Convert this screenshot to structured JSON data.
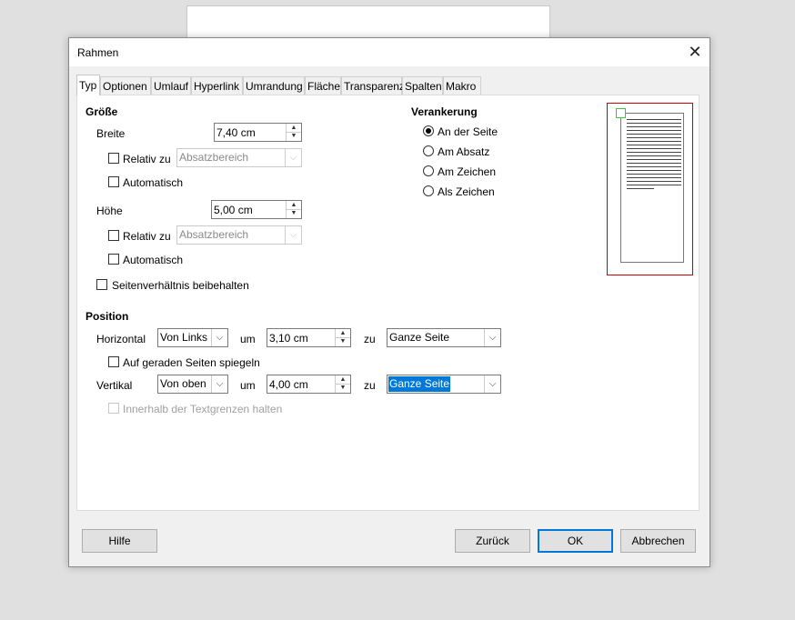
{
  "dialog": {
    "title": "Rahmen"
  },
  "tabs": [
    "Typ",
    "Optionen",
    "Umlauf",
    "Hyperlink",
    "Umrandung",
    "Fläche",
    "Transparenz",
    "Spalten",
    "Makro"
  ],
  "size": {
    "title": "Größe",
    "width_label": "Breite",
    "width_value": "7,40 cm",
    "width_relative_label": "Relativ zu",
    "width_relative_option": "Absatzbereich",
    "width_auto_label": "Automatisch",
    "height_label": "Höhe",
    "height_value": "5,00 cm",
    "height_relative_label": "Relativ zu",
    "height_relative_option": "Absatzbereich",
    "height_auto_label": "Automatisch",
    "keep_ratio_label": "Seitenverhältnis beibehalten"
  },
  "anchor": {
    "title": "Verankerung",
    "options": [
      "An der Seite",
      "Am Absatz",
      "Am Zeichen",
      "Als Zeichen"
    ],
    "selected": "An der Seite"
  },
  "position": {
    "title": "Position",
    "horizontal_label": "Horizontal",
    "horizontal_value": "Von Links",
    "by_label": "um",
    "horizontal_by": "3,10 cm",
    "to_label": "zu",
    "horizontal_to": "Ganze Seite",
    "mirror_label": "Auf geraden Seiten spiegeln",
    "vertical_label": "Vertikal",
    "vertical_value": "Von oben",
    "vertical_by": "4,00 cm",
    "vertical_to": "Ganze Seite",
    "follow_label": "Innerhalb der Textgrenzen halten"
  },
  "buttons": {
    "help": "Hilfe",
    "reset": "Zurück",
    "ok": "OK",
    "cancel": "Abbrechen"
  }
}
